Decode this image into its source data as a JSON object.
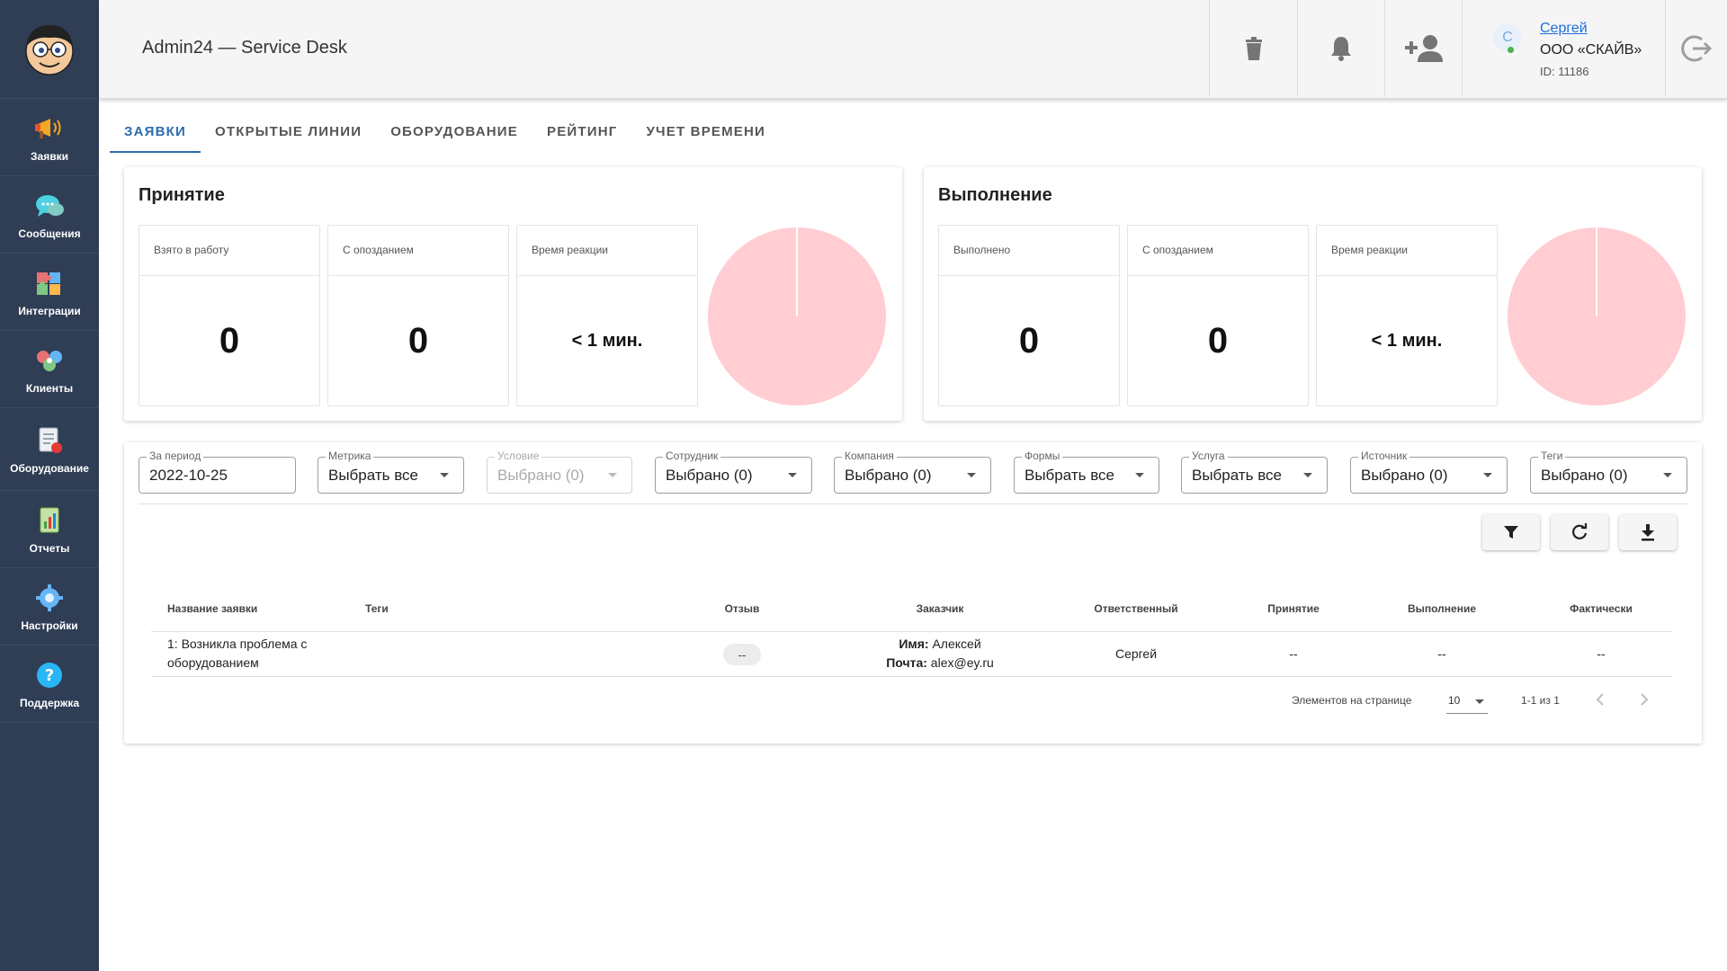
{
  "sidebar": {
    "items": [
      {
        "label": "Заявки",
        "icon": "megaphone-icon"
      },
      {
        "label": "Сообщения",
        "icon": "chat-bubble-icon"
      },
      {
        "label": "Интеграции",
        "icon": "puzzle-icon"
      },
      {
        "label": "Клиенты",
        "icon": "clients-icon"
      },
      {
        "label": "Оборудование",
        "icon": "equipment-icon"
      },
      {
        "label": "Отчеты",
        "icon": "report-icon"
      },
      {
        "label": "Настройки",
        "icon": "gear-icon"
      },
      {
        "label": "Поддержка",
        "icon": "help-icon"
      }
    ]
  },
  "header": {
    "title": "Admin24 — Service Desk",
    "user": {
      "avatar_letter": "С",
      "name": "Сергей",
      "org": "ООО «СКАЙВ»",
      "id": "ID: 11186"
    }
  },
  "tabs": [
    {
      "label": "ЗАЯВКИ",
      "active": true
    },
    {
      "label": "ОТКРЫТЫЕ ЛИНИИ"
    },
    {
      "label": "ОБОРУДОВАНИЕ"
    },
    {
      "label": "РЕЙТИНГ"
    },
    {
      "label": "УЧЕТ ВРЕМЕНИ"
    }
  ],
  "acceptance": {
    "title": "Принятие",
    "metrics": [
      {
        "label": "Взято в работу",
        "value": "0"
      },
      {
        "label": "С опозданием",
        "value": "0"
      },
      {
        "label": "Время реакции",
        "value": "< 1 мин."
      }
    ]
  },
  "completion": {
    "title": "Выполнение",
    "metrics": [
      {
        "label": "Выполнено",
        "value": "0"
      },
      {
        "label": "С опозданием",
        "value": "0"
      },
      {
        "label": "Время реакции",
        "value": "< 1 мин."
      }
    ]
  },
  "colors": {
    "pie_fill": "#ffcdd2",
    "accent": "#2b6cb0",
    "sidebar_bg": "#2f3d55"
  },
  "filters": [
    {
      "label": "За период",
      "value": "2022-10-25"
    },
    {
      "label": "Метрика",
      "value": "Выбрать все"
    },
    {
      "label": "Условие",
      "value": "Выбрано (0)",
      "disabled": true
    },
    {
      "label": "Сотрудник",
      "value": "Выбрано (0)"
    },
    {
      "label": "Компания",
      "value": "Выбрано (0)"
    },
    {
      "label": "Формы",
      "value": "Выбрать все"
    },
    {
      "label": "Услуга",
      "value": "Выбрать все"
    },
    {
      "label": "Источник",
      "value": "Выбрано (0)"
    },
    {
      "label": "Теги",
      "value": "Выбрано (0)"
    }
  ],
  "table": {
    "columns": [
      "Название заявки",
      "Теги",
      "Отзыв",
      "Заказчик",
      "Ответственный",
      "Принятие",
      "Выполнение",
      "Фактически"
    ],
    "rows": [
      {
        "name_line1": "1: Возникла проблема с",
        "name_line2": "оборудованием",
        "tags": "",
        "feedback": "--",
        "customer_name_label": "Имя:",
        "customer_name": "Алексей",
        "customer_mail_label": "Почта:",
        "customer_mail": "alex@ey.ru",
        "responsible": "Сергей",
        "acceptance": "--",
        "completion": "--",
        "actual": "--"
      }
    ]
  },
  "pagination": {
    "per_page_label": "Элементов на странице",
    "per_page": "10",
    "range": "1-1 из 1"
  }
}
